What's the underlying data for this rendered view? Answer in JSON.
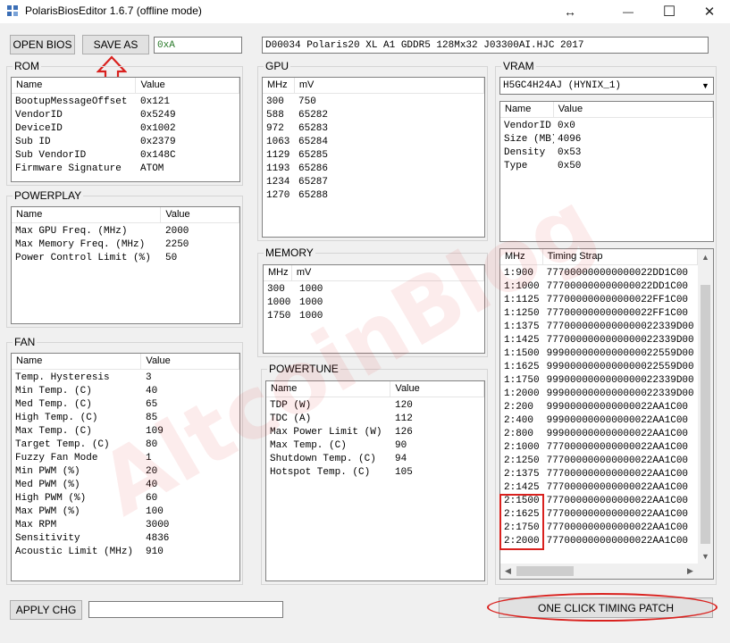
{
  "window": {
    "title": "PolarisBiosEditor 1.6.7 (offline mode)",
    "resize_glyph": "↔",
    "minimize_glyph": "—",
    "maximize_glyph": "☐",
    "close_glyph": "✕"
  },
  "toolbar": {
    "open_label": "OPEN BIOS",
    "save_label": "SAVE AS",
    "status_value": "0xA",
    "bios_string": "D00034 Polaris20 XL A1 GDDR5 128Mx32 J03300AI.HJC 2017"
  },
  "rom": {
    "title": "ROM",
    "col_name": "Name",
    "col_value": "Value",
    "rows": [
      [
        "BootupMessageOffset",
        "0x121"
      ],
      [
        "VendorID",
        "0x5249"
      ],
      [
        "DeviceID",
        "0x1002"
      ],
      [
        "Sub ID",
        "0x2379"
      ],
      [
        "Sub VendorID",
        "0x148C"
      ],
      [
        "Firmware Signature",
        "ATOM"
      ]
    ]
  },
  "powerplay": {
    "title": "POWERPLAY",
    "col_name": "Name",
    "col_value": "Value",
    "rows": [
      [
        "Max GPU Freq. (MHz)",
        "2000"
      ],
      [
        "Max Memory Freq. (MHz)",
        "2250"
      ],
      [
        "Power Control Limit (%)",
        "50"
      ]
    ]
  },
  "fan": {
    "title": "FAN",
    "col_name": "Name",
    "col_value": "Value",
    "rows": [
      [
        "Temp. Hysteresis",
        "3"
      ],
      [
        "Min Temp. (C)",
        "40"
      ],
      [
        "Med Temp. (C)",
        "65"
      ],
      [
        "High Temp. (C)",
        "85"
      ],
      [
        "Max Temp. (C)",
        "109"
      ],
      [
        "Target Temp. (C)",
        "80"
      ],
      [
        "Fuzzy Fan Mode",
        "1"
      ],
      [
        "Min PWM (%)",
        "20"
      ],
      [
        "Med PWM (%)",
        "40"
      ],
      [
        "High PWM (%)",
        "60"
      ],
      [
        "Max PWM (%)",
        "100"
      ],
      [
        "Max RPM",
        "3000"
      ],
      [
        "Sensitivity",
        "4836"
      ],
      [
        "Acoustic Limit (MHz)",
        "910"
      ]
    ]
  },
  "gpu": {
    "title": "GPU",
    "col_mhz": "MHz",
    "col_mv": "mV",
    "rows": [
      [
        "300",
        "750"
      ],
      [
        "588",
        "65282"
      ],
      [
        "972",
        "65283"
      ],
      [
        "1063",
        "65284"
      ],
      [
        "1129",
        "65285"
      ],
      [
        "1193",
        "65286"
      ],
      [
        "1234",
        "65287"
      ],
      [
        "1270",
        "65288"
      ]
    ]
  },
  "memory": {
    "title": "MEMORY",
    "col_mhz": "MHz",
    "col_mv": "mV",
    "rows": [
      [
        "300",
        "1000"
      ],
      [
        "1000",
        "1000"
      ],
      [
        "1750",
        "1000"
      ]
    ]
  },
  "powertune": {
    "title": "POWERTUNE",
    "col_name": "Name",
    "col_value": "Value",
    "rows": [
      [
        "TDP (W)",
        "120"
      ],
      [
        "TDC (A)",
        "112"
      ],
      [
        "Max Power Limit (W)",
        "126"
      ],
      [
        "Max Temp. (C)",
        "90"
      ],
      [
        "Shutdown Temp. (C)",
        "94"
      ],
      [
        "Hotspot Temp. (C)",
        "105"
      ]
    ]
  },
  "vram": {
    "title": "VRAM",
    "selected_memory": "H5GC4H24AJ (HYNIX_1)",
    "col_name": "Name",
    "col_value": "Value",
    "rows": [
      [
        "VendorID",
        "0x0"
      ],
      [
        "Size (MB)",
        "4096"
      ],
      [
        "Density",
        "0x53"
      ],
      [
        "Type",
        "0x50"
      ]
    ],
    "timing_col_mhz": "MHz",
    "timing_col_strap": "Timing Strap",
    "timings": [
      [
        "1:900",
        "777000000000000022DD1C00"
      ],
      [
        "1:1000",
        "777000000000000022DD1C00"
      ],
      [
        "1:1125",
        "777000000000000022FF1C00"
      ],
      [
        "1:1250",
        "777000000000000022FF1C00"
      ],
      [
        "1:1375",
        "7770000000000000022339D00"
      ],
      [
        "1:1425",
        "7770000000000000022339D00"
      ],
      [
        "1:1500",
        "9990000000000000022559D00"
      ],
      [
        "1:1625",
        "9990000000000000022559D00"
      ],
      [
        "1:1750",
        "9990000000000000022339D00"
      ],
      [
        "1:2000",
        "9990000000000000022339D00"
      ],
      [
        "2:200",
        "999000000000000022AA1C00"
      ],
      [
        "2:400",
        "999000000000000022AA1C00"
      ],
      [
        "2:800",
        "999000000000000022AA1C00"
      ],
      [
        "2:1000",
        "777000000000000022AA1C00"
      ],
      [
        "2:1250",
        "777000000000000022AA1C00"
      ],
      [
        "2:1375",
        "777000000000000022AA1C00"
      ],
      [
        "2:1425",
        "777000000000000022AA1C00"
      ],
      [
        "2:1500",
        "777000000000000022AA1C00"
      ],
      [
        "2:1625",
        "777000000000000022AA1C00"
      ],
      [
        "2:1750",
        "777000000000000022AA1C00"
      ],
      [
        "2:2000",
        "777000000000000022AA1C00"
      ]
    ]
  },
  "footer": {
    "apply_label": "APPLY CHG",
    "apply_value": "",
    "patch_label": "ONE CLICK TIMING PATCH"
  },
  "watermark": "AltcoinBlog",
  "colors": {
    "annotation_red": "#d9211e",
    "status_green": "#2a7a2a"
  }
}
